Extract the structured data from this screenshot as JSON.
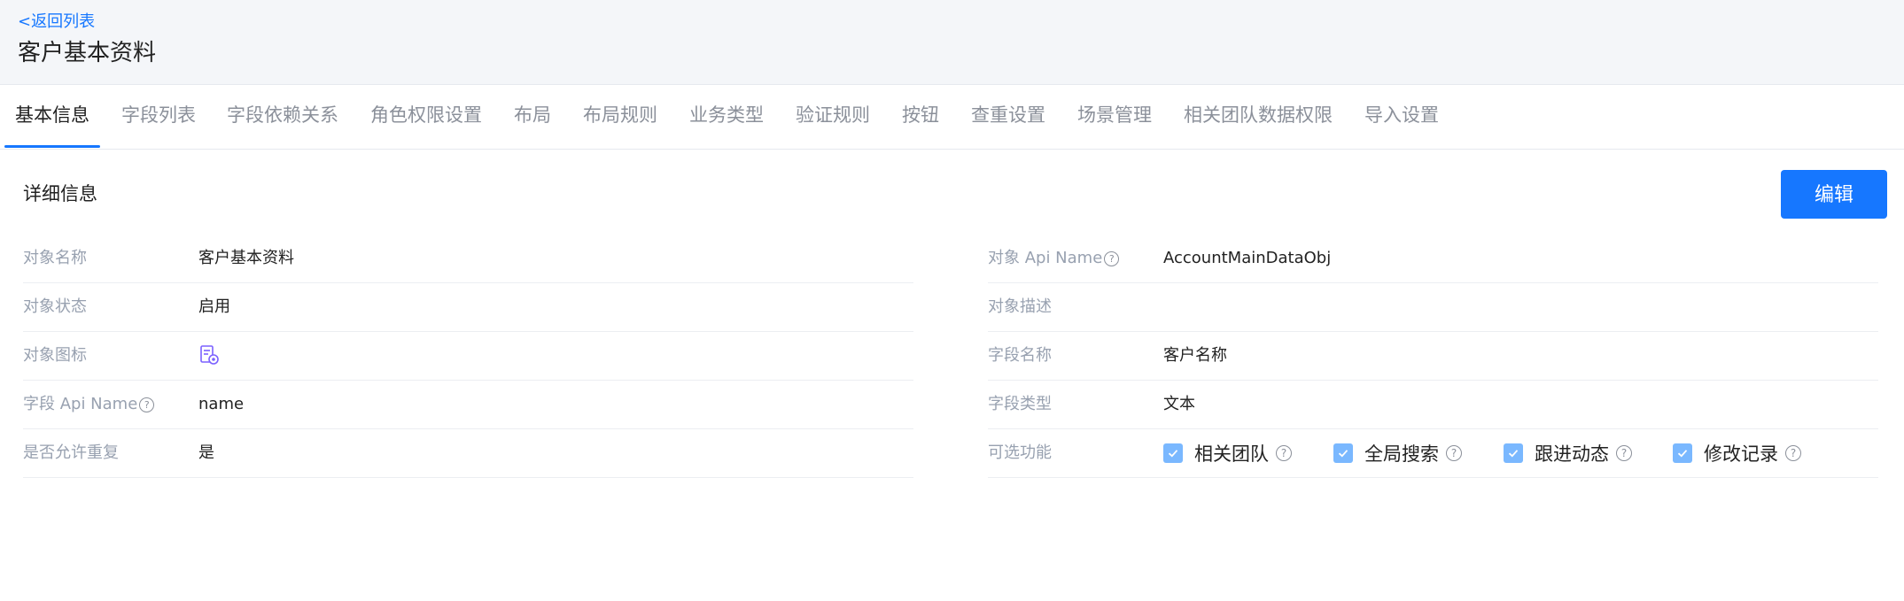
{
  "header": {
    "back_link": "<返回列表",
    "title": "客户基本资料"
  },
  "tabs": [
    {
      "label": "基本信息",
      "active": true
    },
    {
      "label": "字段列表"
    },
    {
      "label": "字段依赖关系"
    },
    {
      "label": "角色权限设置"
    },
    {
      "label": "布局"
    },
    {
      "label": "布局规则"
    },
    {
      "label": "业务类型"
    },
    {
      "label": "验证规则"
    },
    {
      "label": "按钮"
    },
    {
      "label": "查重设置"
    },
    {
      "label": "场景管理"
    },
    {
      "label": "相关团队数据权限"
    },
    {
      "label": "导入设置"
    }
  ],
  "detail": {
    "section_title": "详细信息",
    "edit_label": "编辑",
    "left_rows": [
      {
        "label": "对象名称",
        "value": "客户基本资料"
      },
      {
        "label": "对象状态",
        "value": "启用"
      },
      {
        "label": "对象图标",
        "value": ""
      },
      {
        "label": "字段 Api Name",
        "value": "name"
      },
      {
        "label": "是否允许重复",
        "value": "是"
      }
    ],
    "right_rows": [
      {
        "label": "对象 Api Name",
        "value": "AccountMainDataObj"
      },
      {
        "label": "对象描述",
        "value": ""
      },
      {
        "label": "字段名称",
        "value": "客户名称"
      },
      {
        "label": "字段类型",
        "value": "文本"
      },
      {
        "label": "可选功能",
        "value": ""
      }
    ],
    "features": [
      {
        "label": "相关团队",
        "checked": true
      },
      {
        "label": "全局搜索",
        "checked": true
      },
      {
        "label": "跟进动态",
        "checked": true
      },
      {
        "label": "修改记录",
        "checked": true
      }
    ]
  },
  "icons": {
    "help": "?",
    "object_icon": "object-document-icon",
    "check": "checkmark-icon"
  },
  "colors": {
    "accent": "#1677ff",
    "checkbox": "#7ab8ff",
    "icon_purple": "#7b61ff"
  }
}
